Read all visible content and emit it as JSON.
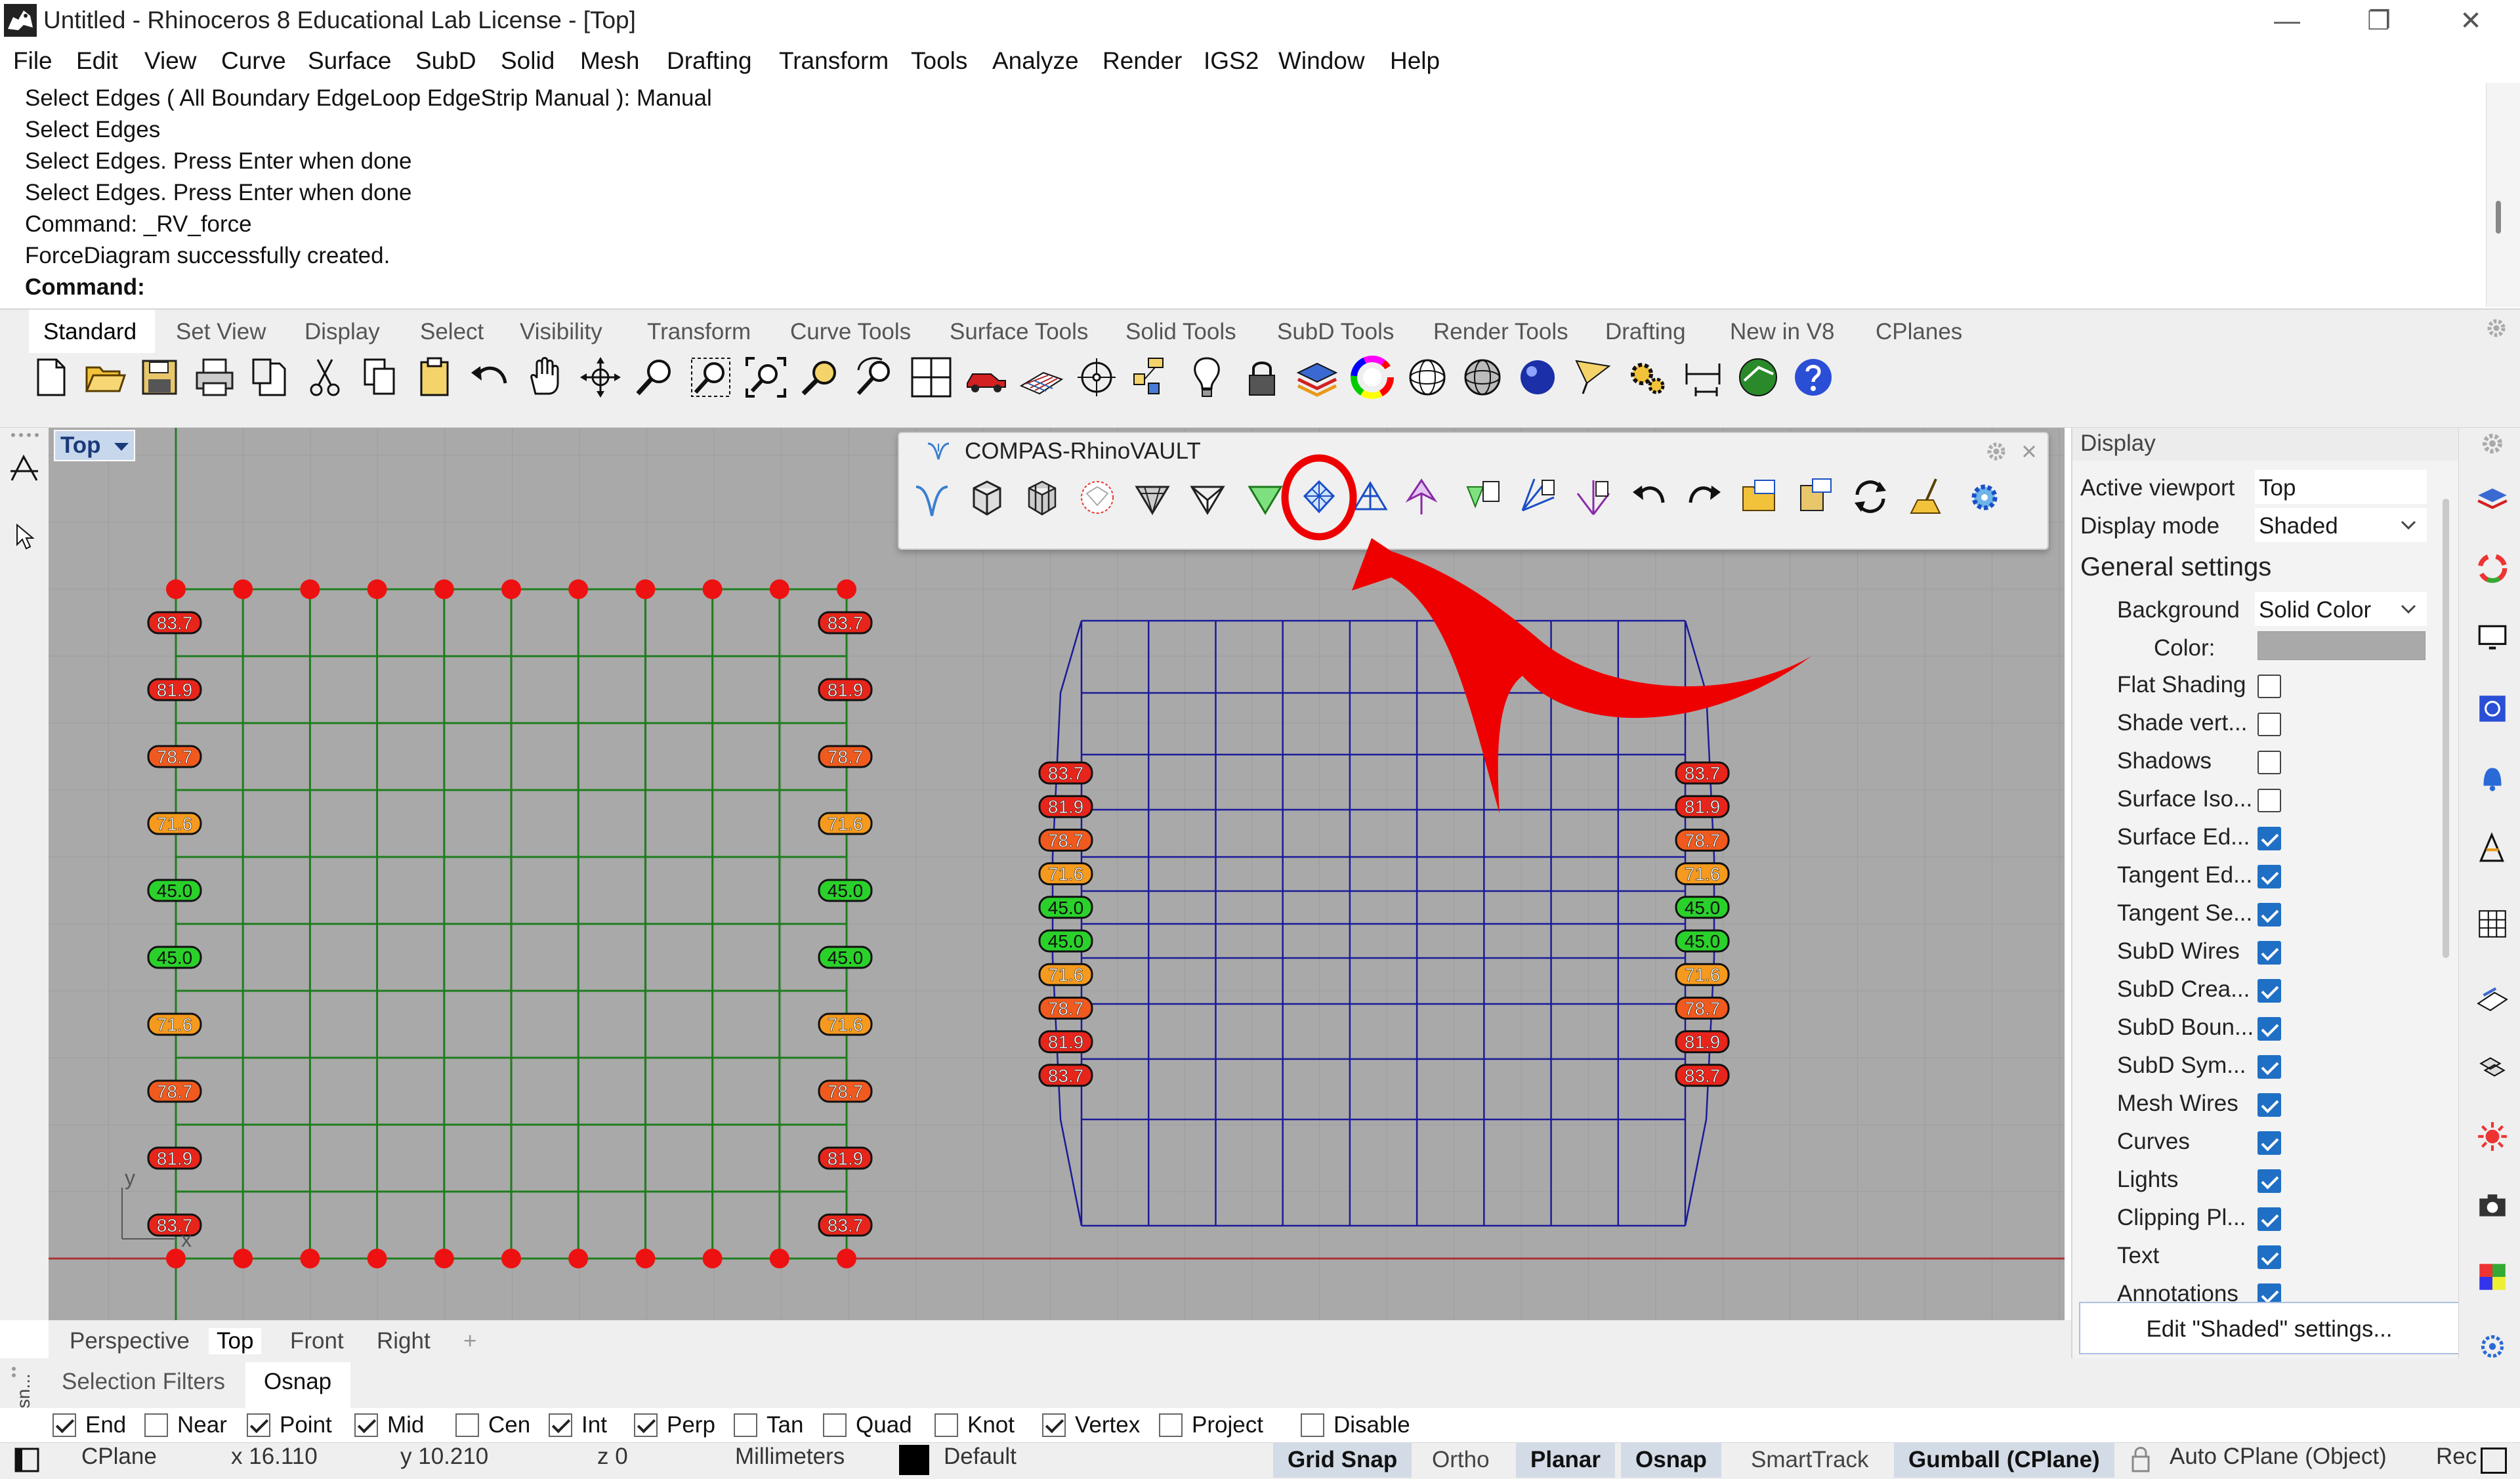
{
  "window": {
    "title": "Untitled - Rhinoceros 8 Educational Lab License - [Top]",
    "minimize": "—",
    "maximize": "❐",
    "close": "✕"
  },
  "menu": [
    "File",
    "Edit",
    "View",
    "Curve",
    "Surface",
    "SubD",
    "Solid",
    "Mesh",
    "Drafting",
    "Transform",
    "Tools",
    "Analyze",
    "Render",
    "IGS2",
    "Window",
    "Help"
  ],
  "command_history": [
    "Select Edges ( All  Boundary  EdgeLoop  EdgeStrip  Manual ): Manual",
    "Select Edges",
    "Select Edges. Press Enter when done",
    "Select Edges. Press Enter when done",
    "Command: _RV_force",
    "ForceDiagram successfully created."
  ],
  "command_prompt": "Command:",
  "toolbar_tabs": [
    "Standard",
    "Set View",
    "Display",
    "Select",
    "Visibility",
    "Transform",
    "Curve Tools",
    "Surface Tools",
    "Solid Tools",
    "SubD Tools",
    "Render Tools",
    "Drafting",
    "New in V8",
    "CPlanes"
  ],
  "toolbar_icons": [
    "new-file",
    "open-file",
    "save",
    "print",
    "import",
    "cut",
    "copy",
    "paste",
    "undo",
    "pan-hand",
    "rotate-view",
    "zoom",
    "zoom-window",
    "zoom-extents",
    "zoom-selected",
    "rotate-camera",
    "four-viewports",
    "car-named-views",
    "grid-cplane",
    "gumball-point",
    "snap-points",
    "light-bulb",
    "lock",
    "layer-stack",
    "color-wheel",
    "sphere-wireframe",
    "sphere-rendered",
    "sphere-blue",
    "triangle-flag",
    "gears",
    "dimension",
    "globe-green",
    "help"
  ],
  "viewport": {
    "name": "Top",
    "tabs": [
      "Perspective",
      "Top",
      "Front",
      "Right"
    ],
    "active_tab": "Top",
    "add_tab": "+",
    "axis_y": "y",
    "axis_x": "x"
  },
  "form_labels_left": [
    "83.7",
    "81.9",
    "78.7",
    "71.6",
    "45.0",
    "45.0",
    "71.6",
    "78.7",
    "81.9",
    "83.7"
  ],
  "force_labels": [
    "83.7",
    "81.9",
    "78.7",
    "71.6",
    "45.0",
    "45.0",
    "71.6",
    "78.7",
    "81.9",
    "83.7"
  ],
  "label_colors": {
    "83.7": "#e8251b",
    "81.9": "#e8251b",
    "78.7": "#f05a1e",
    "71.6": "#f59a1e",
    "45.0": "#2ad12a"
  },
  "compas_panel": {
    "title": "COMPAS-RhinoVAULT",
    "icons": [
      "rv-logo",
      "box-wire",
      "box-mesh",
      "circle-mesh",
      "triangle-dark",
      "triangle-wire",
      "triangle-green",
      "diamond-mesh-highlighted",
      "tri-blue",
      "arrow-purple",
      "stack-green",
      "fan-blue",
      "fan-purple",
      "undo",
      "redo",
      "rv-folder",
      "rv-save",
      "refresh",
      "broom",
      "settings-gear"
    ],
    "highlighted_icon": "diamond-mesh-highlighted"
  },
  "display_panel": {
    "header": "Display",
    "active_viewport_label": "Active viewport",
    "active_viewport_value": "Top",
    "display_mode_label": "Display mode",
    "display_mode_value": "Shaded",
    "general_settings": "General settings",
    "background_label": "Background",
    "background_value": "Solid Color",
    "color_label": "Color:",
    "color_value": "#a9a9a9",
    "options": [
      {
        "label": "Flat Shading",
        "checked": false
      },
      {
        "label": "Shade vert...",
        "checked": false
      },
      {
        "label": "Shadows",
        "checked": false
      },
      {
        "label": "Surface Iso...",
        "checked": false
      },
      {
        "label": "Surface Ed...",
        "checked": true
      },
      {
        "label": "Tangent Ed...",
        "checked": true
      },
      {
        "label": "Tangent Se...",
        "checked": true
      },
      {
        "label": "SubD Wires",
        "checked": true
      },
      {
        "label": "SubD Crea...",
        "checked": true
      },
      {
        "label": "SubD Boun...",
        "checked": true
      },
      {
        "label": "SubD Sym...",
        "checked": true
      },
      {
        "label": "Mesh Wires",
        "checked": true
      },
      {
        "label": "Curves",
        "checked": true
      },
      {
        "label": "Lights",
        "checked": true
      },
      {
        "label": "Clipping Pl...",
        "checked": true
      },
      {
        "label": "Text",
        "checked": true
      },
      {
        "label": "Annotations",
        "checked": true
      }
    ],
    "edit_button": "Edit \"Shaded\" settings..."
  },
  "bottom_tabs": [
    "Selection Filters",
    "Osnap"
  ],
  "osnap_side_label": "Osn...",
  "osnaps": [
    {
      "label": "End",
      "checked": true
    },
    {
      "label": "Near",
      "checked": false
    },
    {
      "label": "Point",
      "checked": true
    },
    {
      "label": "Mid",
      "checked": true
    },
    {
      "label": "Cen",
      "checked": false
    },
    {
      "label": "Int",
      "checked": true
    },
    {
      "label": "Perp",
      "checked": true
    },
    {
      "label": "Tan",
      "checked": false
    },
    {
      "label": "Quad",
      "checked": false
    },
    {
      "label": "Knot",
      "checked": false
    },
    {
      "label": "Vertex",
      "checked": true
    },
    {
      "label": "Project",
      "checked": false
    },
    {
      "label": "Disable",
      "checked": false
    }
  ],
  "status": {
    "cplane": "CPlane",
    "x": "x 16.110",
    "y": "y 10.210",
    "z": "z 0",
    "units": "Millimeters",
    "layer": "Default",
    "layer_color": "#000000",
    "grid_snap": "Grid Snap",
    "ortho": "Ortho",
    "planar": "Planar",
    "osnap": "Osnap",
    "smarttrack": "SmartTrack",
    "gumball": "Gumball (CPlane)",
    "auto_cplane": "Auto CPlane (Object)",
    "rec": "Rec"
  },
  "colors": {
    "viewport_bg": "#a9a9a9",
    "form_grid": "#1e7d1e",
    "force_grid": "#1a1a9a",
    "node": "#ee1111",
    "annotation_red": "#ee0000",
    "accent_blue": "#1f6fc5"
  }
}
